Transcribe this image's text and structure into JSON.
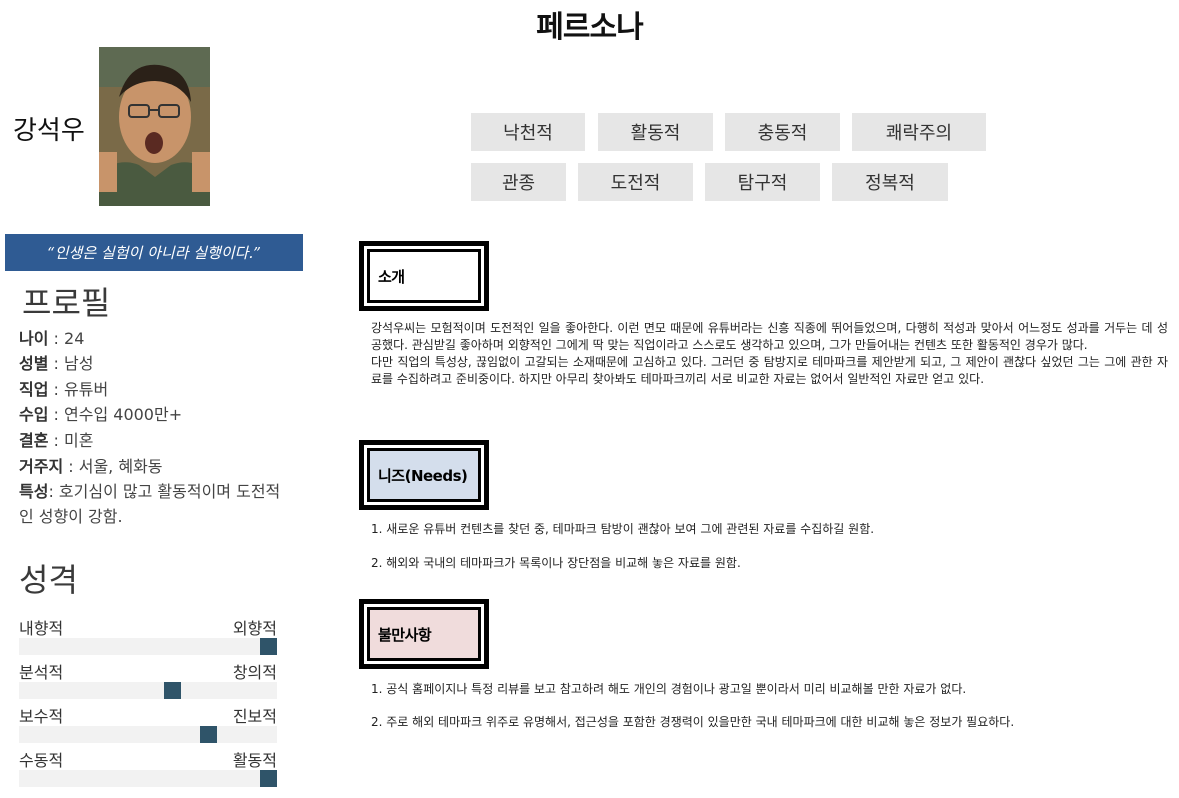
{
  "title": "페르소나",
  "person": {
    "name": "강석우"
  },
  "traits": [
    "낙천적",
    "활동적",
    "충동적",
    "쾌락주의",
    "관종",
    "도전적",
    "탐구적",
    "정복적"
  ],
  "quote": "“인생은 실험이 아니라 실행이다.”",
  "profile": {
    "heading": "프로필",
    "items": [
      {
        "label": "나이",
        "value": " : 24"
      },
      {
        "label": "성별",
        "value": " : 남성"
      },
      {
        "label": "직업",
        "value": " : 유튜버"
      },
      {
        "label": "수입",
        "value": " : 연수입 4000만+"
      },
      {
        "label": "결혼",
        "value": " : 미혼"
      },
      {
        "label": "거주지",
        "value": " : 서울, 혜화동"
      },
      {
        "label": "특성",
        "value": ": 호기심이 많고 활동적이며 도전적인 성향이 강함."
      }
    ]
  },
  "personality": {
    "heading": "성격",
    "scales": [
      {
        "left": "내향적",
        "right": "외향적",
        "level": 1.0
      },
      {
        "left": "분석적",
        "right": "창의적",
        "level": 0.6
      },
      {
        "left": "보수적",
        "right": "진보적",
        "level": 0.75
      },
      {
        "left": "수동적",
        "right": "활동적",
        "level": 1.0
      }
    ]
  },
  "intro": {
    "title": "소개",
    "paragraphs": [
      " 강석우씨는 모험적이며 도전적인 일을 좋아한다. 이런 면모 때문에 유튜버라는 신흥 직종에 뛰어들었으며, 다행히 적성과 맞아서 어느정도 성과를 거두는 데 성공했다. 관심받길 좋아하며 외향적인 그에게 딱 맞는 직업이라고 스스로도 생각하고 있으며, 그가 만들어내는 컨텐츠 또한 활동적인 경우가 많다.",
      " 다만 직업의 특성상, 끊임없이 고갈되는 소재때문에 고심하고 있다. 그러던 중 탐방지로 테마파크를 제안받게 되고, 그 제안이 괜찮다 싶었던 그는 그에 관한 자료를 수집하려고 준비중이다. 하지만 아무리 찾아봐도 테마파크끼리 서로 비교한 자료는 없어서 일반적인 자료만 얻고 있다."
    ]
  },
  "needs": {
    "title": "니즈(Needs)",
    "color": "#d4deec",
    "items": [
      "1. 새로운 유튜버 컨텐츠를 찾던 중, 테마파크 탐방이 괜찮아 보여 그에 관련된 자료를 수집하길 원함.",
      "2. 해외와 국내의 테마파크가 목록이나 장단점을 비교해 놓은 자료를 원함."
    ]
  },
  "complaints": {
    "title": "불만사항",
    "color": "#f0dcdc",
    "items": [
      "1. 공식 홈페이지나 특정 리뷰를 보고 참고하려 해도 개인의 경험이나 광고일 뿐이라서 미리 비교해볼 만한 자료가 없다.",
      "2. 주로 해외 테마파크 위주로 유명해서, 접근성을 포함한 경쟁력이 있을만한 국내 테마파크에 대한 비교해 놓은 정보가 필요하다."
    ]
  },
  "colors": {
    "quote_bg": "#2f5b93",
    "scale_marker": "#2f5469",
    "trait_bg": "#e6e6e6"
  }
}
